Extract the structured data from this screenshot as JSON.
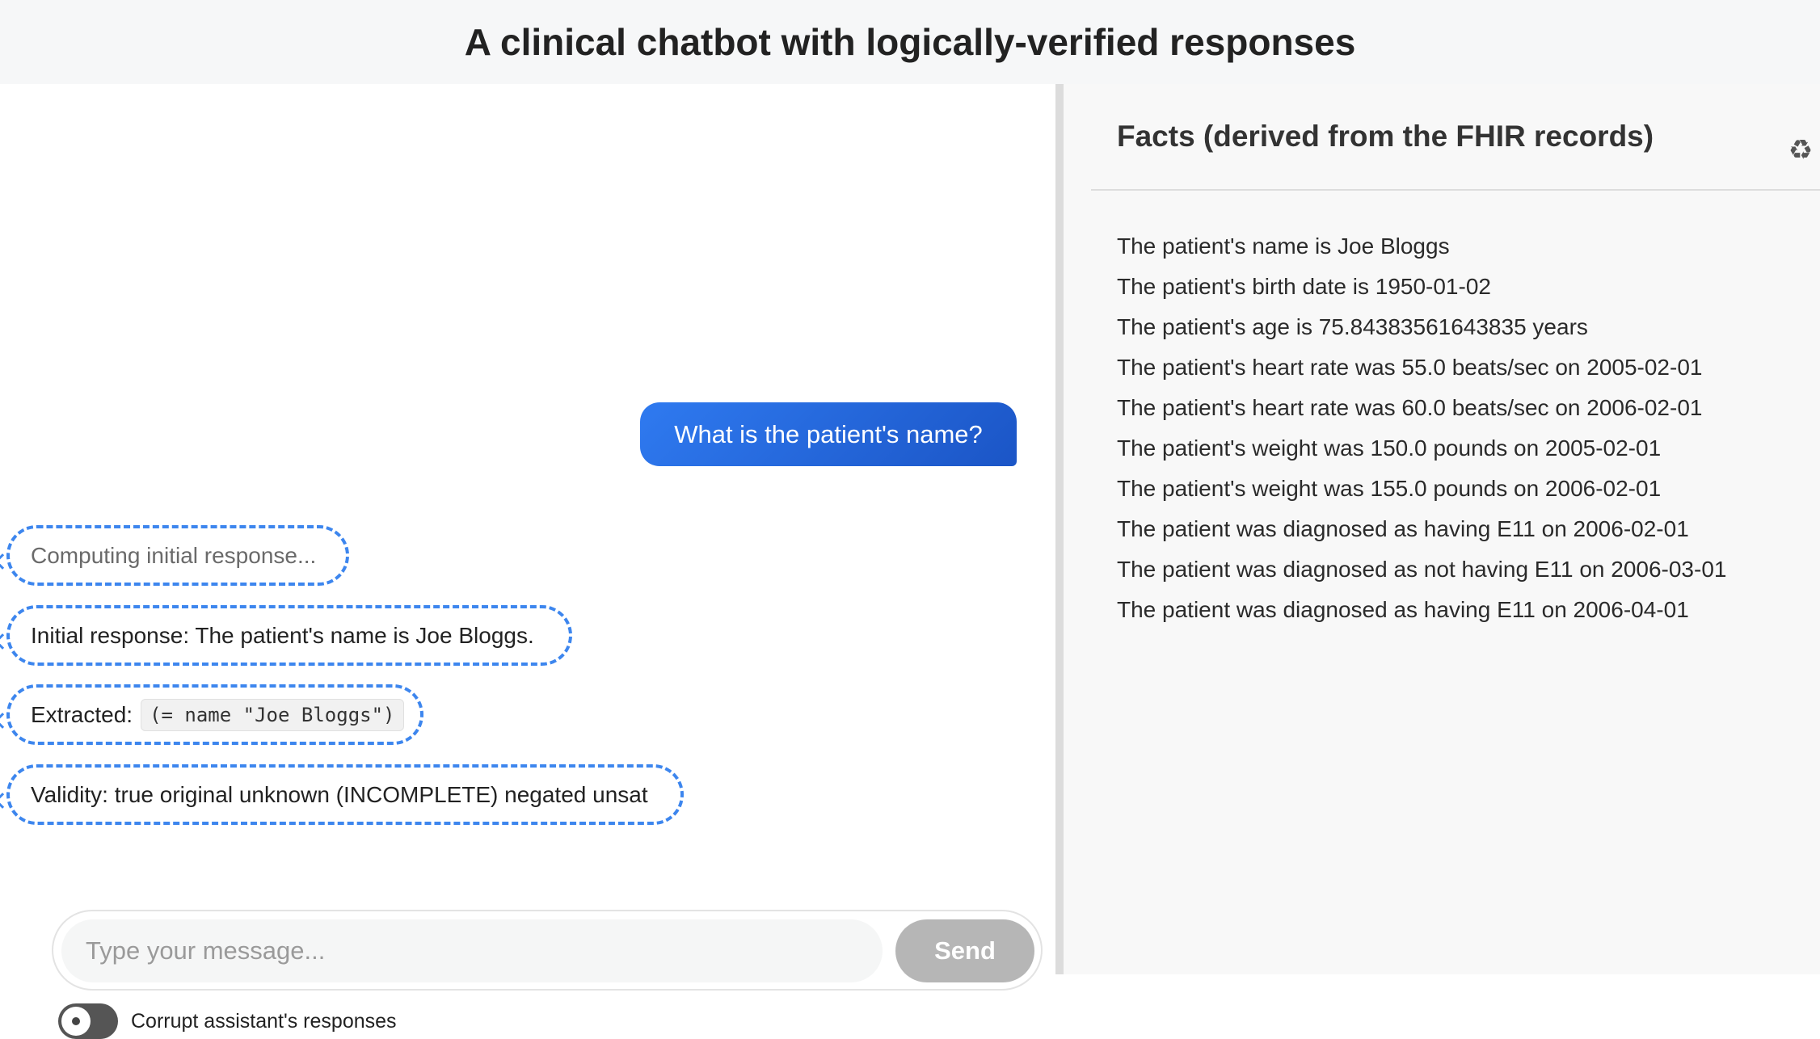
{
  "header": {
    "title": "A clinical chatbot with logically-verified responses"
  },
  "chat": {
    "user_message": "What is the patient's name?",
    "computing_text": "Computing initial response...",
    "initial_response": "Initial response: The patient's name is Joe Bloggs.",
    "extracted_label": "Extracted:",
    "extracted_code": "(= name \"Joe Bloggs\")",
    "validity": "Validity: true original unknown (INCOMPLETE) negated unsat"
  },
  "composer": {
    "placeholder": "Type your message...",
    "value": "",
    "send_label": "Send",
    "send_enabled": false
  },
  "toggle": {
    "label": "Corrupt assistant's responses",
    "on": false
  },
  "facts": {
    "title": "Facts (derived from the FHIR records)",
    "refresh_icon": "recycle-icon",
    "items": [
      "The patient's name is Joe Bloggs",
      "The patient's birth date is 1950-01-02",
      "The patient's age is 75.84383561643835 years",
      "The patient's heart rate was 55.0 beats/sec on 2005-02-01",
      "The patient's heart rate was 60.0 beats/sec on 2006-02-01",
      "The patient's weight was 150.0 pounds on 2005-02-01",
      "The patient's weight was 155.0 pounds on 2006-02-01",
      "The patient was diagnosed as having E11 on 2006-02-01",
      "The patient was diagnosed as not having E11 on 2006-03-01",
      "The patient was diagnosed as having E11 on 2006-04-01"
    ]
  },
  "colors": {
    "user_bubble": "#2f7af0",
    "bot_border": "#3d86ee",
    "send_disabled": "#b6b6b6",
    "toggle_off": "#555555",
    "header_bg": "#f6f7f8",
    "facts_bg": "#f8f8f8"
  }
}
